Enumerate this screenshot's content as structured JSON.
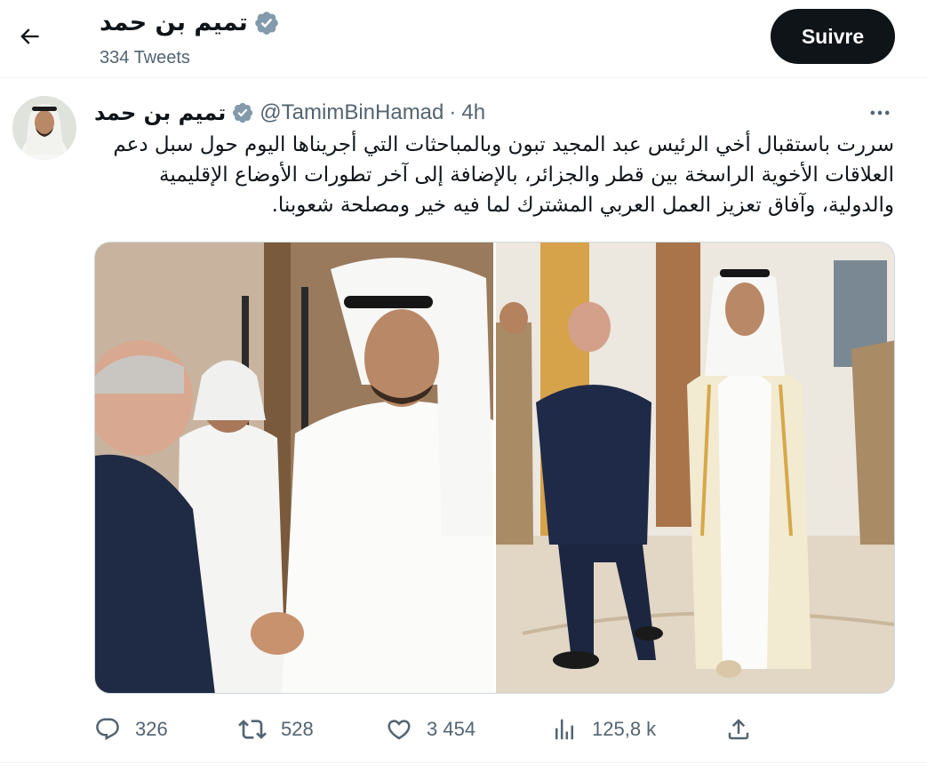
{
  "header": {
    "back_label": "Back",
    "display_name": "تميم بن حمد",
    "tweet_count": "334 Tweets",
    "follow_label": "Suivre"
  },
  "tweet": {
    "author_name": "تميم بن حمد",
    "handle": "@TamimBinHamad",
    "separator": "·",
    "time": "4h",
    "text": "سررت باستقبال أخي الرئيس عبد المجيد تبون وبالمباحثات التي أجريناها اليوم حول سبل دعم العلاقات الأخوية الراسخة بين قطر والجزائر، بالإضافة إلى آخر تطورات الأوضاع الإقليمية والدولية، وآفاق تعزيز العمل العربي المشترك لما فيه خير ومصلحة شعوبنا.",
    "media_count": 2
  },
  "actions": {
    "replies": "326",
    "retweets": "528",
    "likes": "3 454",
    "views": "125,8 k"
  },
  "icons": {
    "back": "arrow-left-icon",
    "verified": "verified-badge-icon",
    "more": "more-horizontal-icon",
    "reply": "reply-icon",
    "retweet": "retweet-icon",
    "like": "heart-icon",
    "views": "analytics-icon",
    "share": "share-icon"
  },
  "colors": {
    "text_primary": "#0f1419",
    "text_secondary": "#536471",
    "border": "#eff3f4",
    "verified_badge": "#829aab",
    "follow_bg": "#0f1419"
  }
}
